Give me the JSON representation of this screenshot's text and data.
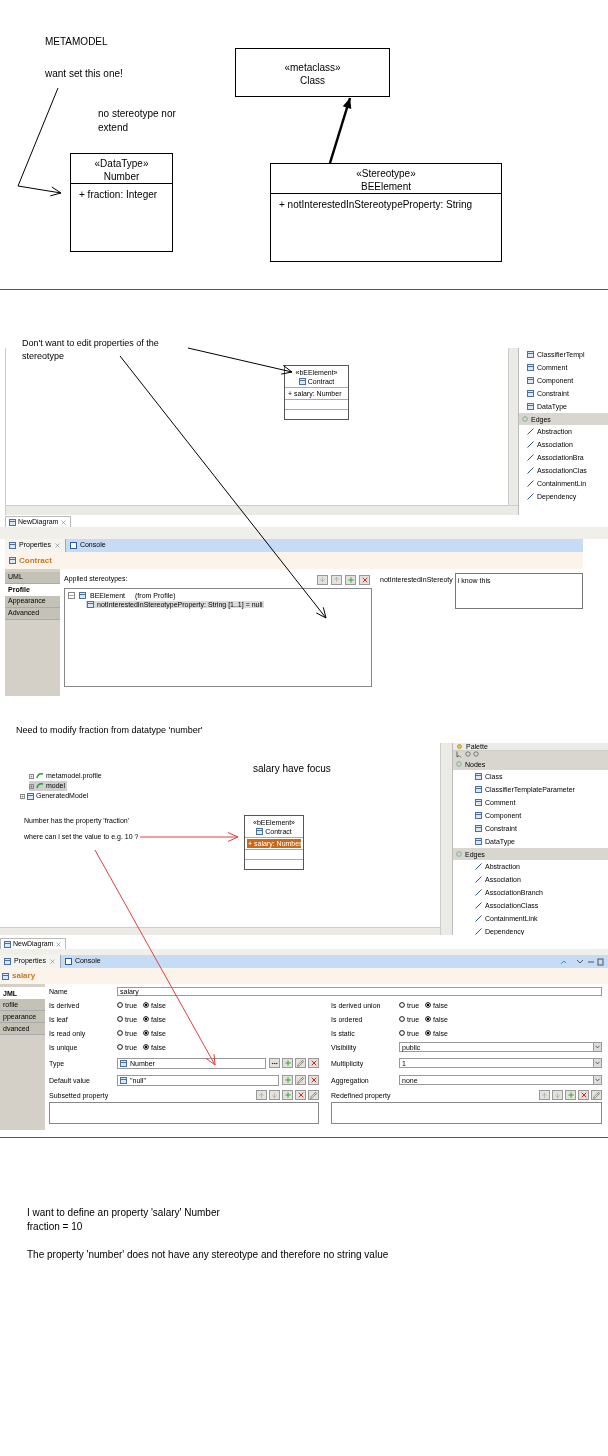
{
  "metamodel": {
    "title": "METAMODEL",
    "notes": [
      "want set this one!",
      "no stereotype nor extend"
    ],
    "classes": [
      {
        "stereotype": "«metaclass»",
        "name": "Class"
      },
      {
        "stereotype": "«DataType»",
        "name": "Number",
        "attributes": [
          "+ fraction: Integer"
        ]
      },
      {
        "stereotype": "«Stereotype»",
        "name": "BEElement",
        "attributes": [
          "+ notInterestedInStereotypeProperty: String"
        ]
      }
    ]
  },
  "screenshot_1": {
    "note": "Don't want to edit properties of the stereotype",
    "element": {
      "stereotype": "«bEElement»",
      "name": "Contract",
      "attributes": [
        {
          "text": "+ salary: Number",
          "selected": false
        }
      ]
    },
    "palette": {
      "groups": [
        {
          "items": [
            {
              "label": "ClassifierTempl",
              "kind": "node"
            },
            {
              "label": "Comment",
              "kind": "node"
            },
            {
              "label": "Component",
              "kind": "node"
            },
            {
              "label": "Constraint",
              "kind": "node"
            },
            {
              "label": "DataType",
              "kind": "node"
            }
          ]
        },
        {
          "label": "Edges",
          "items": [
            {
              "label": "Abstraction",
              "kind": "edge"
            },
            {
              "label": "Association",
              "kind": "edge"
            },
            {
              "label": "AssociationBra",
              "kind": "edge"
            },
            {
              "label": "AssociationClas",
              "kind": "edge"
            },
            {
              "label": "ContainmentLin",
              "kind": "edge"
            },
            {
              "label": "Dependency",
              "kind": "edge"
            }
          ]
        }
      ]
    },
    "editor_tab": "NewDiagram",
    "view_tabs": [
      {
        "label": "Properties",
        "selected": true
      },
      {
        "label": "Console",
        "selected": false
      }
    ],
    "title": "Contract",
    "side_tabs": [
      {
        "label": "UML",
        "selected": false
      },
      {
        "label": "Profile",
        "selected": true
      },
      {
        "label": "Appearance",
        "selected": false
      },
      {
        "label": "Advanced",
        "selected": false
      }
    ],
    "stereotypes_label": "Applied stereotypes:",
    "tree": [
      {
        "label": "BEElement",
        "suffix": "(from Profile)",
        "expanded": true,
        "selected": false,
        "children": [
          {
            "label": "notInterestedInStereotypeProperty: String [1..1] = null",
            "selected": true
          }
        ]
      }
    ],
    "property_label": "notInterestedInStereoty",
    "property_value": "i know this"
  },
  "screenshot_2": {
    "heading_note": "Need to modify fraction from datatype 'number'",
    "focus_note": "salary have focus",
    "question_notes": [
      "Number has the property 'fraction'",
      "where can i set the value to e.g. 10 ?"
    ],
    "model_tree": [
      {
        "label": "metamodel.profile",
        "kind": "profile",
        "selected": false
      },
      {
        "label": "model",
        "kind": "profile",
        "selected": true
      },
      {
        "label": "GeneratedModel",
        "kind": "model",
        "selected": false
      }
    ],
    "element": {
      "stereotype": "«bEElement»",
      "name": "Contract",
      "attributes": [
        {
          "text": "+ salary: Number",
          "selected": true
        }
      ]
    },
    "palette": {
      "title": "Palette",
      "groups": [
        {
          "label": "Nodes",
          "items": [
            {
              "label": "Class",
              "kind": "node"
            },
            {
              "label": "ClassifierTemplateParameter",
              "kind": "node"
            },
            {
              "label": "Comment",
              "kind": "node"
            },
            {
              "label": "Component",
              "kind": "node"
            },
            {
              "label": "Constraint",
              "kind": "node"
            },
            {
              "label": "DataType",
              "kind": "node"
            }
          ]
        },
        {
          "label": "Edges",
          "items": [
            {
              "label": "Abstraction",
              "kind": "edge"
            },
            {
              "label": "Association",
              "kind": "edge"
            },
            {
              "label": "AssociationBranch",
              "kind": "edge"
            },
            {
              "label": "AssociationClass",
              "kind": "edge"
            },
            {
              "label": "ContainmentLink",
              "kind": "edge"
            },
            {
              "label": "Dependency",
              "kind": "edge"
            }
          ]
        }
      ]
    },
    "editor_tab": "NewDiagram",
    "view_tabs": [
      {
        "label": "Properties",
        "selected": true
      },
      {
        "label": "Console",
        "selected": false
      }
    ],
    "title": "salary",
    "side_tabs": [
      {
        "label": "JML",
        "selected": true
      },
      {
        "label": "rofile",
        "selected": false
      },
      {
        "label": "ppearance",
        "selected": false
      },
      {
        "label": "dvanced",
        "selected": false
      }
    ],
    "name_field": {
      "label": "Name",
      "value": "salary"
    },
    "left_fields": [
      {
        "kind": "radio",
        "label": "Is derived",
        "options": [
          {
            "label": "true",
            "selected": false
          },
          {
            "label": "false",
            "selected": true
          }
        ]
      },
      {
        "kind": "radio",
        "label": "Is leaf",
        "options": [
          {
            "label": "true",
            "selected": false
          },
          {
            "label": "false",
            "selected": true
          }
        ]
      },
      {
        "kind": "radio",
        "label": "Is read only",
        "options": [
          {
            "label": "true",
            "selected": false
          },
          {
            "label": "false",
            "selected": true
          }
        ]
      },
      {
        "kind": "radio",
        "label": "Is unique",
        "options": [
          {
            "label": "true",
            "selected": false
          },
          {
            "label": "false",
            "selected": true
          }
        ]
      },
      {
        "kind": "reference",
        "label": "Type",
        "value": "Number"
      },
      {
        "kind": "value",
        "label": "Default value",
        "value": "\"null\""
      },
      {
        "kind": "list",
        "label": "Subsetted property"
      }
    ],
    "right_fields": [
      {
        "kind": "radio",
        "label": "Is derived union",
        "options": [
          {
            "label": "true",
            "selected": false
          },
          {
            "label": "false",
            "selected": true
          }
        ]
      },
      {
        "kind": "radio",
        "label": "Is ordered",
        "options": [
          {
            "label": "true",
            "selected": false
          },
          {
            "label": "false",
            "selected": true
          }
        ]
      },
      {
        "kind": "radio",
        "label": "Is static",
        "options": [
          {
            "label": "true",
            "selected": false
          },
          {
            "label": "false",
            "selected": true
          }
        ]
      },
      {
        "kind": "combo",
        "label": "Visibility",
        "value": "public"
      },
      {
        "kind": "combo",
        "label": "Multiplicity",
        "value": "1"
      },
      {
        "kind": "combo",
        "label": "Aggregation",
        "value": "none"
      },
      {
        "kind": "list",
        "label": "Redefined property"
      }
    ]
  },
  "summary": {
    "lines": [
      "I want to define an property 'salary' Number",
      "fraction = 10"
    ],
    "note": "The property 'number' does not have any stereotype and therefore no string value"
  }
}
